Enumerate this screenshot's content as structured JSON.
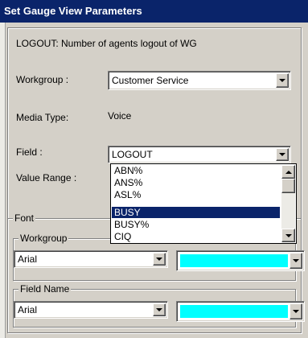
{
  "window": {
    "title": "Set Gauge View Parameters"
  },
  "description": "LOGOUT: Number of agents logout of WG",
  "workgroup": {
    "label": "Workgroup :",
    "value": "Customer Service"
  },
  "media_type": {
    "label": "Media Type:",
    "value": "Voice"
  },
  "field": {
    "label": "Field :",
    "value": "LOGOUT",
    "options": [
      "ABN%",
      "ANS%",
      "ASL%",
      "BUSY",
      "BUSY%",
      "CIQ"
    ],
    "highlighted": "BUSY"
  },
  "value_range": {
    "label": "Value Range :"
  },
  "font_group": {
    "label": "Font",
    "workgroup": {
      "label": "Workgroup",
      "font": "Arial",
      "color": "#00ffff"
    },
    "field_name": {
      "label": "Field Name",
      "font": "Arial",
      "color": "#00ffff"
    }
  },
  "icons": {
    "dropdown": "chevron-down-icon",
    "scroll_up": "arrow-up-icon",
    "scroll_down": "arrow-down-icon"
  },
  "colors": {
    "titlebar": "#0a246a",
    "dialog_bg": "#d4d0c8",
    "selection": "#0a246a",
    "swatch": "#00ffff"
  }
}
